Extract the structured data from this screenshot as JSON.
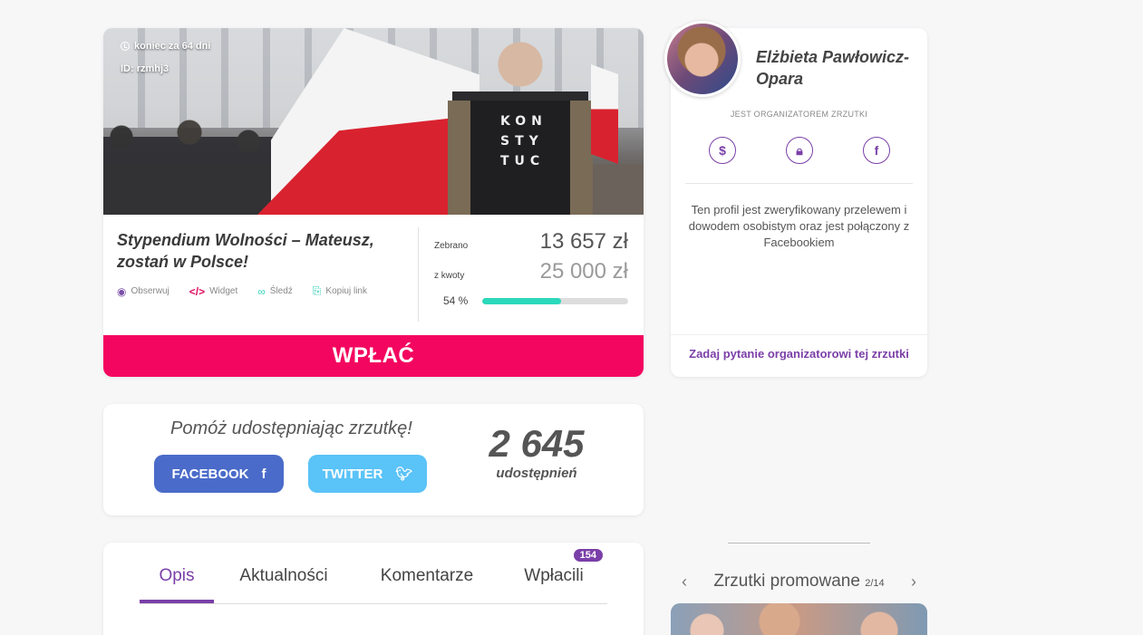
{
  "campaign": {
    "ends_in": "koniec za 64 dni",
    "id_label": "ID: rzmhj3",
    "title": "Stypendium Wolności – Mateusz, zostań w Polsce!",
    "shirt_text": "KON STY TUC",
    "actions": {
      "observe": "Obserwuj",
      "widget": "Widget",
      "follow": "Śledź",
      "copy_link": "Kopiuj link"
    },
    "stats": {
      "collected_label": "Zebrano",
      "collected_value": "13 657 zł",
      "goal_label": "z kwoty",
      "goal_value": "25 000 zł",
      "percent_label": "54 %",
      "progress_percent": 54
    },
    "donate_label": "WPŁAĆ"
  },
  "share": {
    "title": "Pomóż udostępniając zrzutkę!",
    "facebook_label": "FACEBOOK",
    "twitter_label": "TWITTER",
    "count": "2 645",
    "count_label": "udostępnień"
  },
  "tabs": [
    {
      "label": "Opis",
      "active": true
    },
    {
      "label": "Aktualności",
      "active": false
    },
    {
      "label": "Komentarze",
      "active": false
    },
    {
      "label": "Wpłacili",
      "active": false,
      "badge": "154"
    }
  ],
  "organizer": {
    "name": "Elżbieta Pawłowicz-Opara",
    "role": "JEST ORGANIZATOREM ZRZUTKI",
    "verification": "Ten profil jest zweryfikowany przelewem i dowodem osobistym oraz jest połączony z Facebookiem",
    "ask_link": "Zadaj pytanie organizatorowi tej zrzutki"
  },
  "promoted": {
    "title": "Zrzutki promowane",
    "counter": "2/14"
  },
  "colors": {
    "brand_purple": "#7a3fa8",
    "donate_pink": "#f3065f",
    "progress_teal": "#2bd8bb",
    "facebook_blue": "#4a6bc9",
    "twitter_blue": "#5ac3f7"
  }
}
